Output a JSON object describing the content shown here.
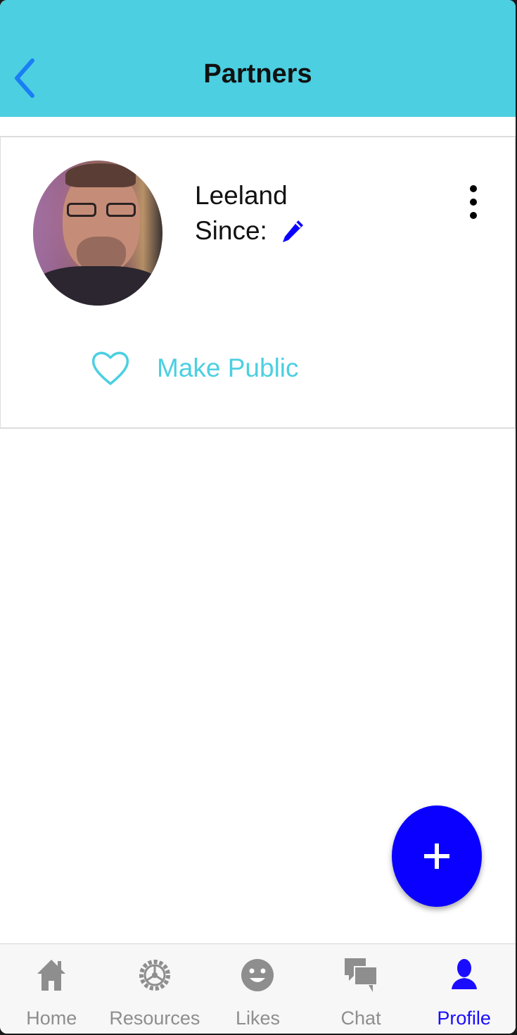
{
  "header": {
    "title": "Partners"
  },
  "partner": {
    "name": "Leeland",
    "since_label": "Since:",
    "make_public_label": "Make Public"
  },
  "tabs": [
    {
      "label": "Home",
      "icon": "home-icon"
    },
    {
      "label": "Resources",
      "icon": "gear-icon"
    },
    {
      "label": "Likes",
      "icon": "smiley-icon"
    },
    {
      "label": "Chat",
      "icon": "chat-bubbles-icon"
    },
    {
      "label": "Profile",
      "icon": "person-icon",
      "active": true
    }
  ],
  "colors": {
    "header_bg": "#4ccfe1",
    "accent_blue": "#0a00ff",
    "back_blue": "#1a7ef5",
    "active_tab": "#1a0dff",
    "inactive_tab": "#8e8e8e"
  }
}
